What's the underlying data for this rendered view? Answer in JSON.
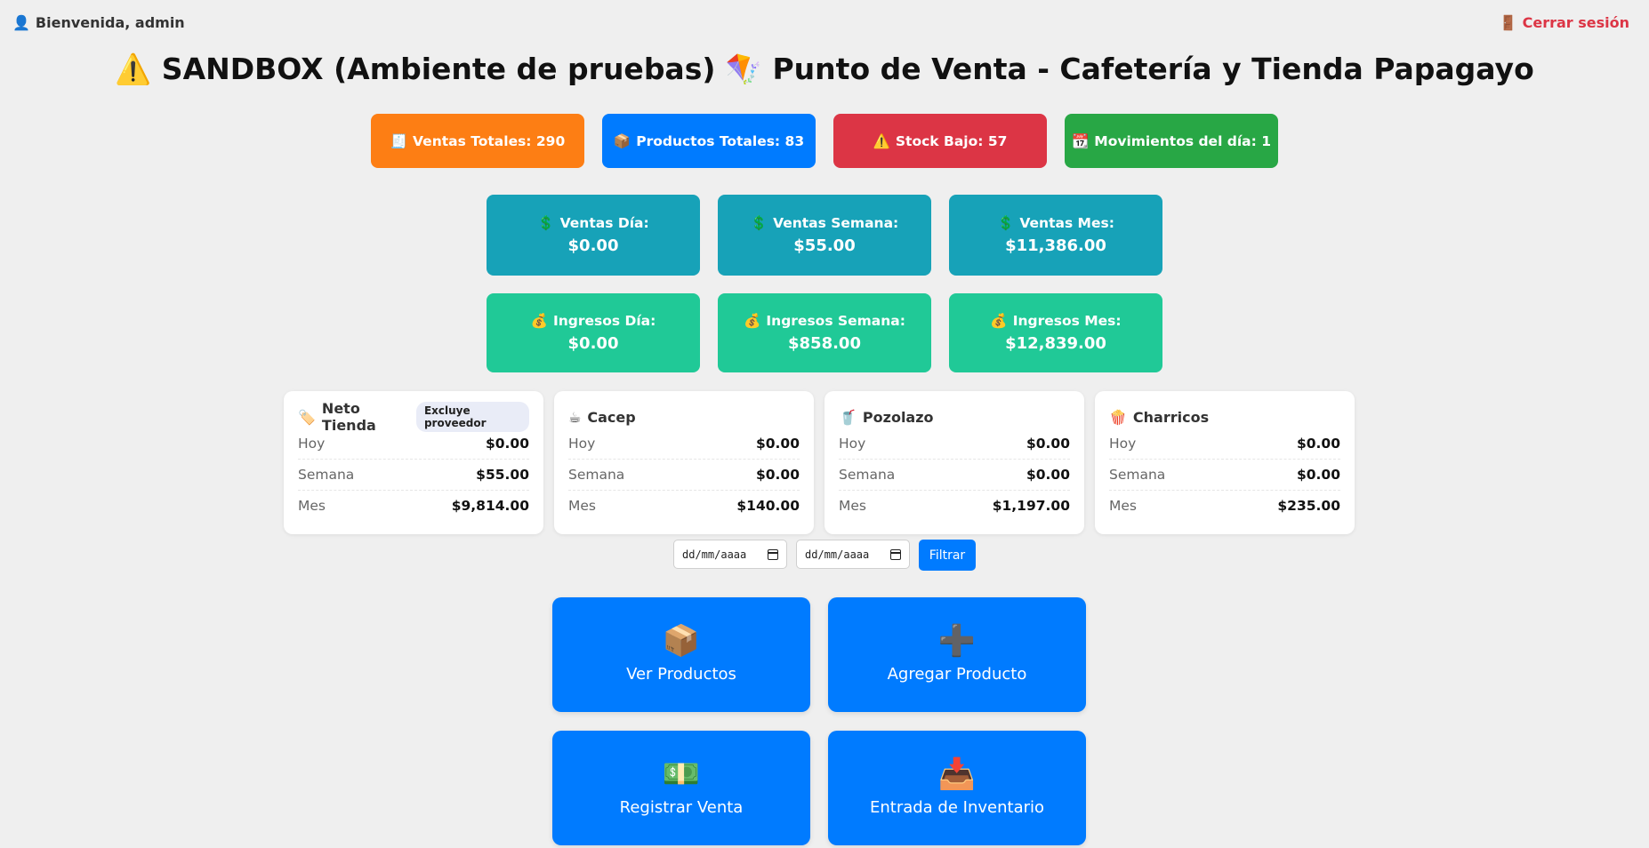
{
  "header": {
    "welcome": "Bienvenida, admin",
    "logout": "Cerrar sesión",
    "title": "⚠️ SANDBOX (Ambiente de pruebas) 🪁 Punto de Venta - Cafetería y Tienda Papagayo"
  },
  "stats": [
    {
      "icon": "🧾",
      "label": "Ventas Totales: 290",
      "color": "#fd7e14"
    },
    {
      "icon": "📦",
      "label": "Productos Totales: 83",
      "color": "#007bff"
    },
    {
      "icon": "⚠️",
      "label": "Stock Bajo: 57",
      "color": "#dc3545"
    },
    {
      "icon": "📆",
      "label": "Movimientos del día: 1",
      "color": "#28a745"
    }
  ],
  "sales": [
    {
      "icon": "💲",
      "label": "Ventas Día:",
      "value": "$0.00"
    },
    {
      "icon": "💲",
      "label": "Ventas Semana:",
      "value": "$55.00"
    },
    {
      "icon": "💲",
      "label": "Ventas Mes:",
      "value": "$11,386.00"
    }
  ],
  "income": [
    {
      "icon": "💰",
      "label": "Ingresos Día:",
      "value": "$0.00"
    },
    {
      "icon": "💰",
      "label": "Ingresos Semana:",
      "value": "$858.00"
    },
    {
      "icon": "💰",
      "label": "Ingresos Mes:",
      "value": "$12,839.00"
    }
  ],
  "cards": [
    {
      "icon": "🏷️",
      "title": "Neto Tienda",
      "badge": "Excluye proveedor",
      "rows": [
        {
          "k": "Hoy",
          "v": "$0.00"
        },
        {
          "k": "Semana",
          "v": "$55.00"
        },
        {
          "k": "Mes",
          "v": "$9,814.00"
        }
      ]
    },
    {
      "icon": "☕",
      "title": "Cacep",
      "badge": "",
      "rows": [
        {
          "k": "Hoy",
          "v": "$0.00"
        },
        {
          "k": "Semana",
          "v": "$0.00"
        },
        {
          "k": "Mes",
          "v": "$140.00"
        }
      ]
    },
    {
      "icon": "🥤",
      "title": "Pozolazo",
      "badge": "",
      "rows": [
        {
          "k": "Hoy",
          "v": "$0.00"
        },
        {
          "k": "Semana",
          "v": "$0.00"
        },
        {
          "k": "Mes",
          "v": "$1,197.00"
        }
      ]
    },
    {
      "icon": "🍿",
      "title": "Charricos",
      "badge": "",
      "rows": [
        {
          "k": "Hoy",
          "v": "$0.00"
        },
        {
          "k": "Semana",
          "v": "$0.00"
        },
        {
          "k": "Mes",
          "v": "$235.00"
        }
      ]
    }
  ],
  "filter": {
    "date_from": "dd/mm/aaaa",
    "date_to": "dd/mm/aaaa",
    "button": "Filtrar"
  },
  "actions": [
    {
      "icon": "📦",
      "label": "Ver Productos"
    },
    {
      "icon": "➕",
      "label": "Agregar Producto"
    },
    {
      "icon": "💵",
      "label": "Registrar Venta"
    },
    {
      "icon": "📥",
      "label": "Entrada de Inventario"
    }
  ]
}
